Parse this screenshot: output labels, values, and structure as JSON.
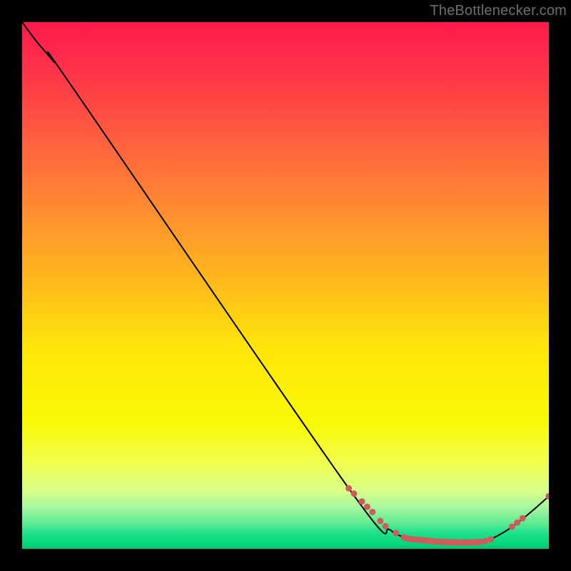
{
  "watermark": "TheBottlenecker.com",
  "chart_data": {
    "type": "line",
    "title": "",
    "xlabel": "",
    "ylabel": "",
    "xlim": [
      0,
      100
    ],
    "ylim": [
      0,
      100
    ],
    "grid": false,
    "legend": false,
    "series": [
      {
        "name": "bottleneck-curve",
        "color": "#000000",
        "points": [
          {
            "x": 0,
            "y": 100
          },
          {
            "x": 3,
            "y": 96
          },
          {
            "x": 6,
            "y": 92.5
          },
          {
            "x": 10,
            "y": 87
          },
          {
            "x": 62,
            "y": 11.5
          },
          {
            "x": 70,
            "y": 3.5
          },
          {
            "x": 75,
            "y": 1.8
          },
          {
            "x": 80,
            "y": 1.2
          },
          {
            "x": 85,
            "y": 1.2
          },
          {
            "x": 88,
            "y": 1.5
          },
          {
            "x": 92,
            "y": 3.5
          },
          {
            "x": 96,
            "y": 6.5
          },
          {
            "x": 100,
            "y": 10
          }
        ]
      }
    ],
    "markers": {
      "color": "#cd5c5c",
      "radius": 4.5,
      "points": [
        {
          "x": 62,
          "y": 11.5
        },
        {
          "x": 63,
          "y": 10.5
        },
        {
          "x": 64.5,
          "y": 9
        },
        {
          "x": 65.5,
          "y": 8
        },
        {
          "x": 66.5,
          "y": 7
        },
        {
          "x": 68,
          "y": 5.3
        },
        {
          "x": 69,
          "y": 4.3
        },
        {
          "x": 71,
          "y": 3.0
        },
        {
          "x": 72.5,
          "y": 2.2
        },
        {
          "x": 73,
          "y": 2.0
        },
        {
          "x": 73.5,
          "y": 1.9
        },
        {
          "x": 74,
          "y": 1.85
        },
        {
          "x": 74.5,
          "y": 1.8
        },
        {
          "x": 75,
          "y": 1.75
        },
        {
          "x": 75.5,
          "y": 1.7
        },
        {
          "x": 76,
          "y": 1.65
        },
        {
          "x": 76.5,
          "y": 1.6
        },
        {
          "x": 77,
          "y": 1.55
        },
        {
          "x": 77.5,
          "y": 1.5
        },
        {
          "x": 78,
          "y": 1.45
        },
        {
          "x": 78.5,
          "y": 1.4
        },
        {
          "x": 79,
          "y": 1.38
        },
        {
          "x": 79.5,
          "y": 1.35
        },
        {
          "x": 80,
          "y": 1.32
        },
        {
          "x": 80.5,
          "y": 1.3
        },
        {
          "x": 81,
          "y": 1.28
        },
        {
          "x": 81.5,
          "y": 1.26
        },
        {
          "x": 82,
          "y": 1.25
        },
        {
          "x": 82.5,
          "y": 1.24
        },
        {
          "x": 83,
          "y": 1.23
        },
        {
          "x": 83.5,
          "y": 1.22
        },
        {
          "x": 84,
          "y": 1.22
        },
        {
          "x": 84.5,
          "y": 1.22
        },
        {
          "x": 85,
          "y": 1.22
        },
        {
          "x": 85.5,
          "y": 1.23
        },
        {
          "x": 86,
          "y": 1.25
        },
        {
          "x": 86.5,
          "y": 1.28
        },
        {
          "x": 87,
          "y": 1.35
        },
        {
          "x": 88,
          "y": 1.5
        },
        {
          "x": 89,
          "y": 1.8
        },
        {
          "x": 93,
          "y": 4.2
        },
        {
          "x": 94,
          "y": 5.0
        },
        {
          "x": 95,
          "y": 5.8
        },
        {
          "x": 100,
          "y": 10.0
        }
      ]
    }
  }
}
